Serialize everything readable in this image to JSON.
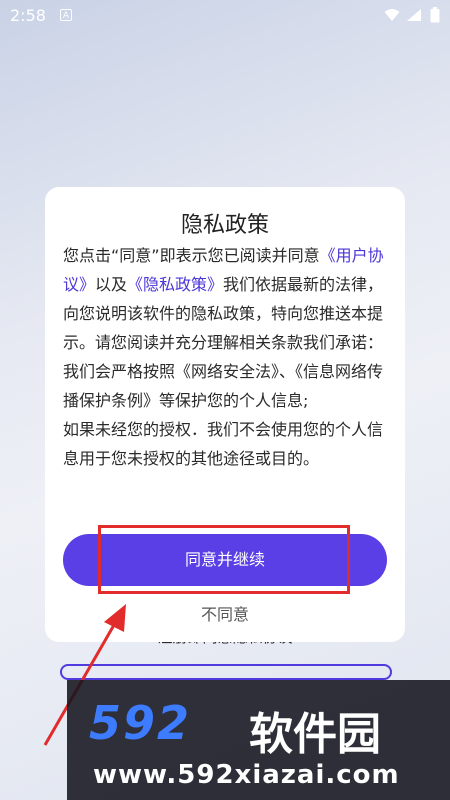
{
  "status_bar": {
    "time": "2:58",
    "keyboard_badge": "A",
    "icons": [
      "wifi-icon",
      "signal-icon",
      "battery-icon"
    ]
  },
  "background": {
    "hint_text": "注册即同意隐私协议"
  },
  "dialog": {
    "title": "隐私政策",
    "intro_prefix": "您点击“同意”即表示您已阅读并同意",
    "user_agreement_link": "《用户协议》",
    "and_text": "以及",
    "privacy_policy_link": "《隐私政策》",
    "intro_suffix": "我们依据最新的法律，向您说明该软件的隐私政策，特向您推送本提示。请您阅读并充分理解相关条款我们承诺：",
    "paragraph_2": "我们会严格按照《网络安全法》、《信息网络传播保护条例》等保护您的个人信息;",
    "paragraph_3": "如果未经您的授权．我们不会使用您的个人信息用于您未授权的其他途径或目的。",
    "agree_button": "同意并继续",
    "disagree_link": "不同意"
  },
  "watermark": {
    "logo_number": "592",
    "logo_text": "软件园",
    "url": "www.592xiazai.com"
  },
  "colors": {
    "accent": "#5a3ee6",
    "link": "#4a36d8",
    "annotation_red": "#e22b2b",
    "watermark_blue": "#3d7bff"
  }
}
